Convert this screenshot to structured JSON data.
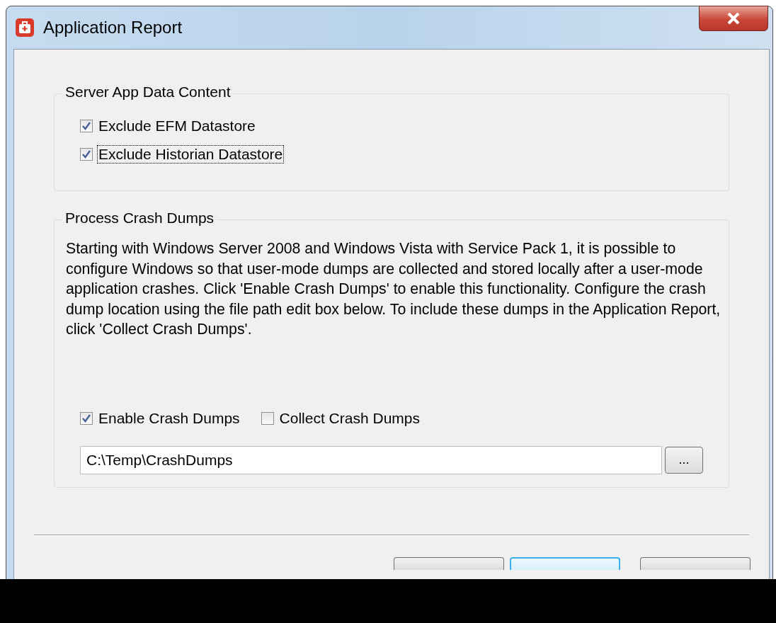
{
  "window": {
    "title": "Application Report"
  },
  "groups": [
    {
      "title": "Server App Data Content",
      "checkboxes": [
        {
          "label": "Exclude EFM Datastore",
          "checked": true,
          "focused": false
        },
        {
          "label": "Exclude Historian Datastore",
          "checked": true,
          "focused": true
        }
      ]
    },
    {
      "title": "Process Crash Dumps",
      "description": "Starting with Windows Server 2008 and Windows Vista with Service Pack 1, it is possible to configure Windows so that user-mode dumps are collected and stored locally after a user-mode application crashes. Click 'Enable Crash Dumps' to enable this functionality. Configure the crash dump location using the file path edit box below. To include these dumps in the Application Report, click 'Collect Crash Dumps'.",
      "checkboxes": [
        {
          "label": "Enable Crash Dumps",
          "checked": true,
          "focused": false
        },
        {
          "label": "Collect Crash Dumps",
          "checked": false,
          "focused": false
        }
      ],
      "path_field": {
        "value": "C:\\Temp\\CrashDumps"
      },
      "browse_button": "..."
    }
  ],
  "footer_buttons": [
    {
      "default": false
    },
    {
      "default": true
    },
    {
      "default": false
    }
  ]
}
